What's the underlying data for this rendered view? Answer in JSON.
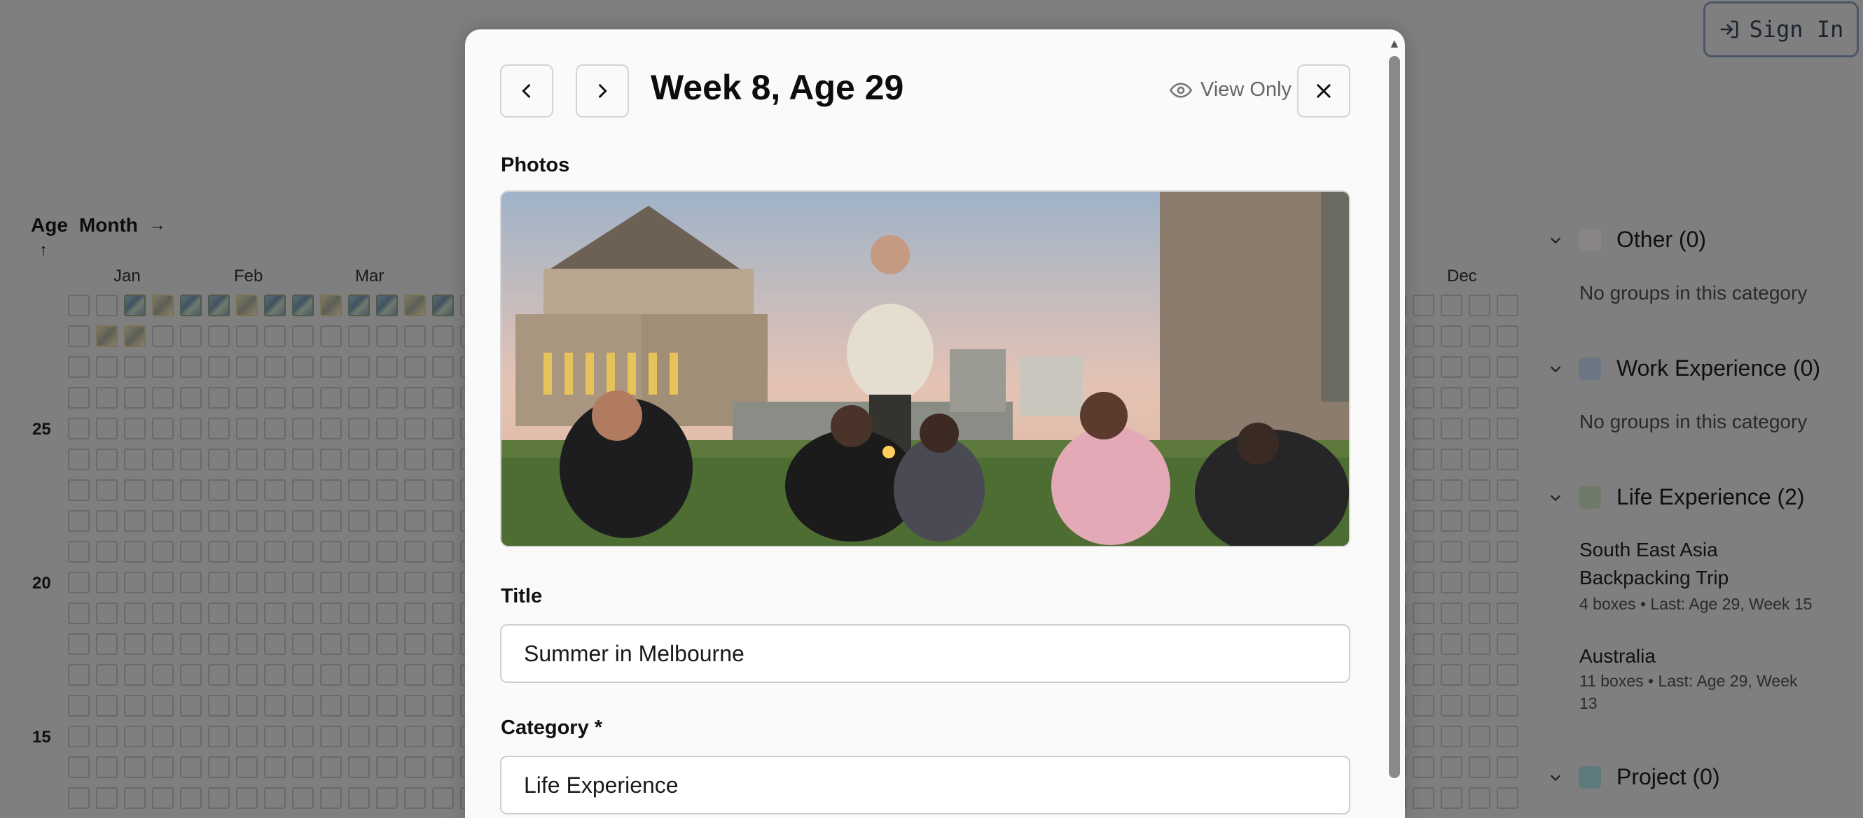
{
  "header": {
    "sign_in_label": "Sign In",
    "sign_in_icon": "sign-in-icon"
  },
  "grid": {
    "age_label": "Age",
    "month_label": "Month",
    "month_arrow": "→",
    "age_arrow": "↑",
    "months": [
      "Jan",
      "Feb",
      "Mar",
      "Dec"
    ],
    "age_ticks": [
      "25",
      "20",
      "15"
    ]
  },
  "modal": {
    "title": "Week 8, Age 29",
    "view_only_label": "View Only",
    "prev_icon": "chevron-left-icon",
    "next_icon": "chevron-right-icon",
    "close_icon": "close-icon",
    "photos_label": "Photos",
    "title_label": "Title",
    "title_value": "Summer in Melbourne",
    "category_label": "Category *",
    "category_value": "Life Experience"
  },
  "sidebar": {
    "categories": [
      {
        "label": "Other (0)",
        "color": "#8a8585",
        "empty_text": "No groups in this category"
      },
      {
        "label": "Work Experience (0)",
        "color": "#6b7685",
        "empty_text": "No groups in this category"
      },
      {
        "label": "Life Experience (2)",
        "color": "#707a68",
        "groups": [
          {
            "title": "South East Asia Backpacking Trip",
            "meta": "4 boxes • Last: Age 29, Week 15"
          },
          {
            "title": "Australia",
            "meta": "11 boxes • Last: Age 29, Week 13"
          }
        ]
      },
      {
        "label": "Project (0)",
        "color": "#5f7a7d"
      }
    ]
  },
  "colors": {
    "overlay": "#7f7f7f",
    "modal_bg": "#fafafa"
  }
}
